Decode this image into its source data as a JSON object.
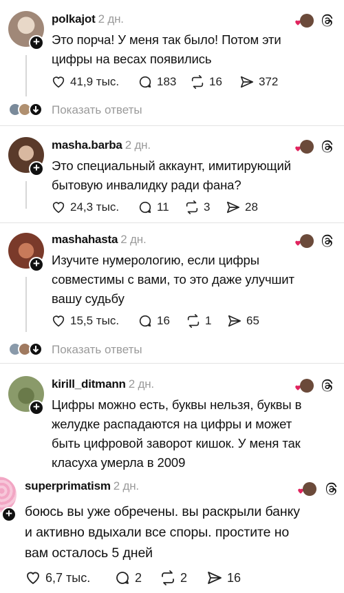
{
  "posts": [
    {
      "username": "polkajot",
      "time": "2 дн.",
      "text_lines": [
        "Это порча! У меня так было! Потом эти",
        "цифры на весах появились"
      ],
      "likes": "41,9 тыс.",
      "comments": "183",
      "reposts": "16",
      "shares": "372",
      "show_replies": "Показать ответы"
    },
    {
      "username": "masha.barba",
      "time": "2 дн.",
      "text_lines": [
        "Это специальный аккаунт, имитирующий",
        "бытовую инвалидку ради фана?"
      ],
      "likes": "24,3 тыс.",
      "comments": "11",
      "reposts": "3",
      "shares": "28"
    },
    {
      "username": "mashahasta",
      "time": "2 дн.",
      "text_lines": [
        "Изучите нумерологию, если цифры",
        "совместимы с вами, то это даже улучшит",
        "вашу судьбу"
      ],
      "likes": "15,5 тыс.",
      "comments": "16",
      "reposts": "1",
      "shares": "65",
      "show_replies": "Показать ответы"
    },
    {
      "username": "kirill_ditmann",
      "time": "2 дн.",
      "text_lines": [
        "Цифры можно есть, буквы нельзя, буквы в",
        "желудке распадаются на цифры и может",
        "быть цифровой заворот кишок. У меня так",
        "класуха умерла в 2009"
      ]
    },
    {
      "username": "superprimatism",
      "time": "2 дн.",
      "text_lines": [
        "боюсь вы уже обречены. вы раскрыли банку",
        "и активно вдыхали все споры. простите но",
        "вам осталось 5 дней"
      ],
      "likes": "6,7 тыс.",
      "comments": "2",
      "reposts": "2",
      "shares": "16"
    }
  ],
  "colors": {
    "heart_red": "#e0245e",
    "muted_text": "#9a9a9a",
    "divider": "#e3e3e3"
  }
}
